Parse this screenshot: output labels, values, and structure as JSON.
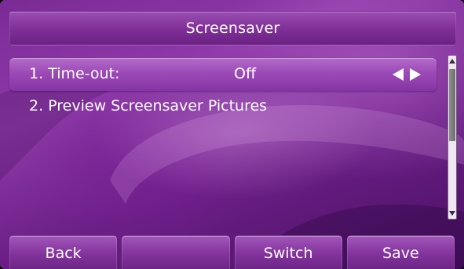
{
  "header": {
    "title": "Screensaver"
  },
  "menu": {
    "items": [
      {
        "label": "1. Time-out:",
        "value": "Off",
        "selected": true,
        "arrows": [
          "left-arrow-icon",
          "right-arrow-icon"
        ]
      },
      {
        "label": "2. Preview Screensaver Pictures",
        "selected": false
      }
    ]
  },
  "scrollbar": {
    "up_icon": "scroll-up-icon",
    "down_icon": "scroll-down-icon"
  },
  "softkeys": [
    {
      "label": "Back"
    },
    {
      "label": ""
    },
    {
      "label": "Switch"
    },
    {
      "label": "Save"
    }
  ],
  "colors": {
    "background": "#7a2a95",
    "selected_row": "#9b4ab6",
    "text": "#ffffff"
  }
}
